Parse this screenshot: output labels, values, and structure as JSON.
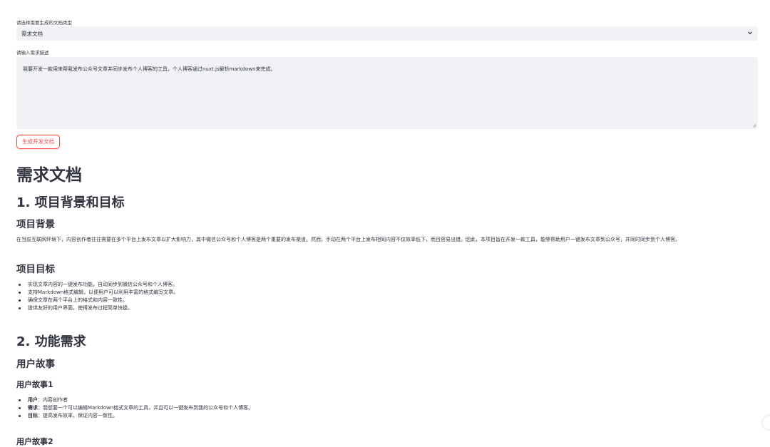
{
  "form": {
    "doc_type_label": "请选择需要生成的文档类型",
    "doc_type_value": "需求文档",
    "desc_label": "请输入需求描述",
    "desc_value": "我要开发一款用来帮我发布公众号文章并同步发布个人博客的工具，个人博客通过nuxt.js解析markdown来完成。",
    "generate_button": "生成开发文档"
  },
  "doc": {
    "title": "需求文档",
    "section1_title": "1. 项目背景和目标",
    "background_title": "项目背景",
    "background_text": "在当前互联网环境下，内容创作者往往需要在多个平台上发布文章以扩大影响力，其中微信公众号和个人博客是两个重要的发布渠道。然而，手动在两个平台上发布相同内容不仅效率低下，而且容易出错。因此，本项目旨在开发一款工具，能够帮助用户一键发布文章到公众号，并同时同步到个人博客。",
    "goals_title": "项目目标",
    "goals": [
      "实现文章内容的一键发布功能，自动同步到微信公众号和个人博客。",
      "支持Markdown格式编辑，以便用户可以利用丰富的格式编写文章。",
      "确保文章在两个平台上的格式和内容一致性。",
      "提供友好的用户界面，使得发布过程简单快捷。"
    ],
    "section2_title": "2. 功能需求",
    "stories_title": "用户故事",
    "story1_title": "用户故事1",
    "story1": [
      {
        "key": "用户",
        "sep": "：",
        "value": "内容创作者"
      },
      {
        "key": "需求",
        "sep": "：",
        "value": "我想要一个可以编辑Markdown格式文章的工具，并且可以一键发布到我的公众号和个人博客。"
      },
      {
        "key": "目标",
        "sep": "：",
        "value": "提高发布效率，保证内容一致性。"
      }
    ],
    "story2_title": "用户故事2"
  },
  "icons": {
    "select_chevron": "chevron-down-icon",
    "resize_grip": "resize-grip-icon"
  },
  "colors": {
    "accent": "#ff4b4b",
    "input_bg": "#f0f2f6",
    "text": "#31333f"
  }
}
